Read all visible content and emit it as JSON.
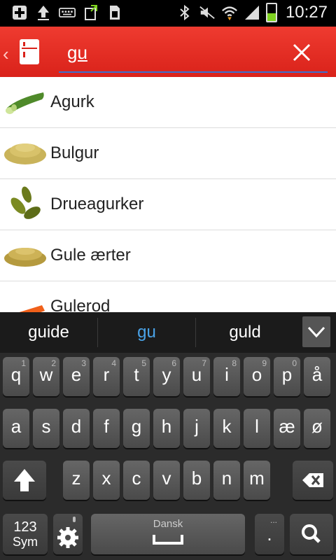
{
  "status_bar": {
    "time": "10:27",
    "battery_level": 0.45,
    "left_icons": [
      "add-icon",
      "upload-icon",
      "keyboard-icon",
      "refresh-icon",
      "sim-icon"
    ],
    "right_icons": [
      "bluetooth-icon",
      "mute-icon",
      "wifi-icon",
      "signal-icon",
      "battery-icon"
    ]
  },
  "action_bar": {
    "search_value": "gu",
    "colors": {
      "bar": "#e4291f",
      "underline": "#3a6fd0"
    }
  },
  "results": [
    {
      "label": "Agurk",
      "image": "cucumber-image"
    },
    {
      "label": "Bulgur",
      "image": "bulgur-image"
    },
    {
      "label": "Drueagurker",
      "image": "gherkins-image"
    },
    {
      "label": "Gule ærter",
      "image": "yellow-peas-image"
    },
    {
      "label": "Gulerod",
      "image": "carrot-image"
    }
  ],
  "suggestions": {
    "items": [
      "guide",
      "gu",
      "guld"
    ],
    "highlight_color": "#4aa3e8"
  },
  "keyboard": {
    "row1": [
      {
        "k": "q",
        "h": "1"
      },
      {
        "k": "w",
        "h": "2"
      },
      {
        "k": "e",
        "h": "3"
      },
      {
        "k": "r",
        "h": "4"
      },
      {
        "k": "t",
        "h": "5"
      },
      {
        "k": "y",
        "h": "6"
      },
      {
        "k": "u",
        "h": "7"
      },
      {
        "k": "i",
        "h": "8"
      },
      {
        "k": "o",
        "h": "9"
      },
      {
        "k": "p",
        "h": "0"
      },
      {
        "k": "å",
        "h": ""
      }
    ],
    "row2": [
      "a",
      "s",
      "d",
      "f",
      "g",
      "h",
      "j",
      "k",
      "l",
      "æ",
      "ø"
    ],
    "row3": [
      "z",
      "x",
      "c",
      "v",
      "b",
      "n",
      "m"
    ],
    "sym_line1": "123",
    "sym_line2": "Sym",
    "space_label": "Dansk",
    "period": ".",
    "period_hint": "..."
  }
}
